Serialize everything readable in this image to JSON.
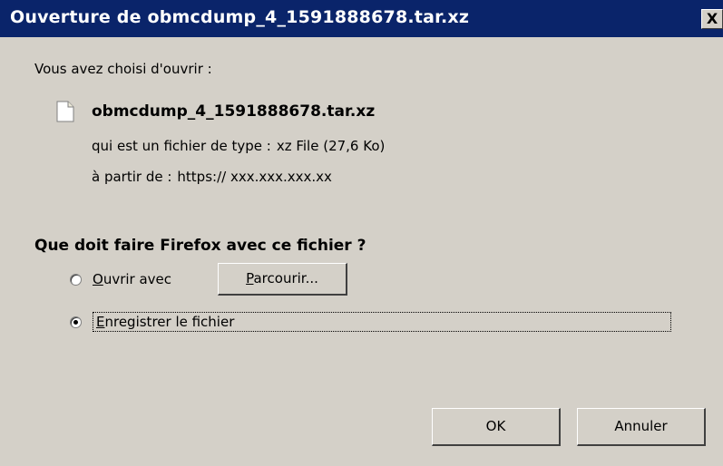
{
  "window": {
    "title": "Ouverture de obmcdump_4_1591888678.tar.xz",
    "close_label": "X"
  },
  "intro": "Vous avez choisi d'ouvrir :",
  "file": {
    "name": "obmcdump_4_1591888678.tar.xz",
    "type_label": "qui est un fichier de type :",
    "type_value": "xz File (27,6 Ko)",
    "from_label": "à partir de :",
    "from_value": "https:// xxx.xxx.xxx.xx",
    "icon": "document-icon"
  },
  "question": "Que doit faire Firefox avec ce fichier ?",
  "options": {
    "open_with": {
      "label_first": "O",
      "label_rest": "uvrir avec",
      "selected": false
    },
    "browse": {
      "label_first": "P",
      "label_rest": "arcourir..."
    },
    "save_file": {
      "label_first": "E",
      "label_rest": "nregistrer le fichier",
      "selected": true
    }
  },
  "buttons": {
    "ok": "OK",
    "cancel": "Annuler"
  },
  "colors": {
    "titlebar": "#0a246a",
    "dialog_bg": "#d4d0c8"
  }
}
